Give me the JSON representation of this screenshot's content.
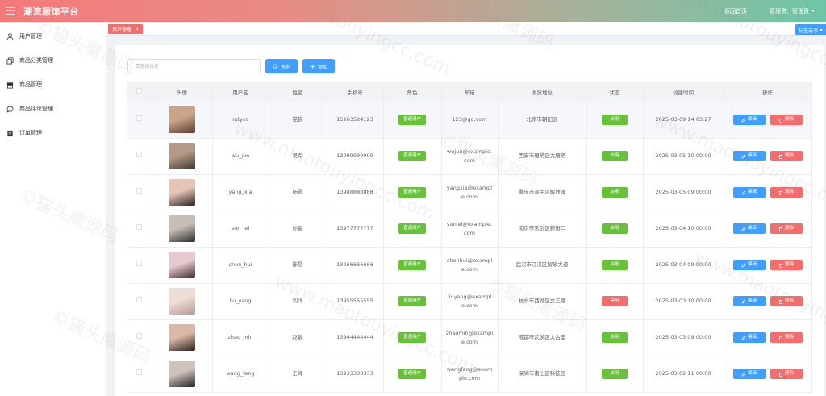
{
  "header": {
    "brand": "潮流服饰平台",
    "back_home": "返回首页",
    "admin_label": "管理员：管理员"
  },
  "sidebar": {
    "items": [
      {
        "label": "用户管理",
        "icon": "user-icon"
      },
      {
        "label": "商品分类管理",
        "icon": "copy-icon"
      },
      {
        "label": "商品管理",
        "icon": "box-icon"
      },
      {
        "label": "商品评论管理",
        "icon": "comment-icon"
      },
      {
        "label": "订单管理",
        "icon": "document-icon"
      }
    ]
  },
  "tabs": {
    "active_label": "用户管理",
    "close_glyph": "×",
    "options_label": "标签选项"
  },
  "search": {
    "placeholder": "请选择姓名",
    "query_label": "查询",
    "add_label": "添加"
  },
  "table": {
    "headers": [
      "",
      "头像",
      "用户名",
      "姓名",
      "手机号",
      "角色",
      "邮箱",
      "收货地址",
      "状态",
      "创建时间",
      "操作"
    ],
    "edit_label": "编辑",
    "delete_label": "删除",
    "rows": [
      {
        "username": "mtycc",
        "name": "猫猫",
        "phone": "15263524123",
        "role": "普通用户",
        "email": [
          "123@qq.com"
        ],
        "address": "北京市朝阳区",
        "status": "启用",
        "created": "2025-03-09 14:03:27",
        "status_color": "#67c23a",
        "avatar_colors": [
          "#c9a489",
          "#5a3b33"
        ]
      },
      {
        "username": "wu_jun",
        "name": "吴军",
        "phone": "13999999999",
        "role": "普通用户",
        "email": [
          "wujun@example.",
          "com"
        ],
        "address": "西安市雁塔区大雁塔",
        "status": "启用",
        "created": "2025-03-05 10:00:00",
        "status_color": "#67c23a",
        "avatar_colors": [
          "#b39a86",
          "#3f3430"
        ]
      },
      {
        "username": "yang_xia",
        "name": "杨霞",
        "phone": "13988888888",
        "role": "普通用户",
        "email": [
          "yangxia@exampl",
          "e.com"
        ],
        "address": "重庆市渝中区解放碑",
        "status": "启用",
        "created": "2025-03-05 09:00:00",
        "status_color": "#67c23a",
        "avatar_colors": [
          "#e3c6b8",
          "#2d211d"
        ]
      },
      {
        "username": "sun_lei",
        "name": "孙磊",
        "phone": "13977777777",
        "role": "普通用户",
        "email": [
          "sunlei@example.",
          "com"
        ],
        "address": "南京市玄武区新街口",
        "status": "启用",
        "created": "2025-03-04 10:00:00",
        "status_color": "#67c23a",
        "avatar_colors": [
          "#c8bdb5",
          "#2a2a2a"
        ]
      },
      {
        "username": "chen_hui",
        "name": "陈慧",
        "phone": "13966666666",
        "role": "普通用户",
        "email": [
          "chenhui@exampl",
          "e.com"
        ],
        "address": "武汉市江汉区解放大道",
        "status": "启用",
        "created": "2025-03-04 09:00:00",
        "status_color": "#67c23a",
        "avatar_colors": [
          "#e8c9cf",
          "#3b2b2b"
        ]
      },
      {
        "username": "liu_yang",
        "name": "刘洋",
        "phone": "13955555555",
        "role": "普通用户",
        "email": [
          "liuyang@exampl",
          "e.com"
        ],
        "address": "杭州市西湖区文三路",
        "status": "禁用",
        "created": "2025-03-03 10:00:00",
        "status_color": "#f56c6c",
        "avatar_colors": [
          "#f0dcd6",
          "#b79a92"
        ]
      },
      {
        "username": "zhao_min",
        "name": "赵敏",
        "phone": "13944444444",
        "role": "普通用户",
        "email": [
          "zhaomin@exampl",
          "e.com"
        ],
        "address": "成都市武侯区太古里",
        "status": "启用",
        "created": "2025-03-03 09:00:00",
        "status_color": "#67c23a",
        "avatar_colors": [
          "#d9b8a8",
          "#2b1f1c"
        ]
      },
      {
        "username": "wang_feng",
        "name": "王峰",
        "phone": "13933333333",
        "role": "普通用户",
        "email": [
          "wangfeng@exam",
          "ple.com"
        ],
        "address": "深圳市南山区科技园",
        "status": "启用",
        "created": "2025-03-02 11:00:00",
        "status_color": "#67c23a",
        "avatar_colors": [
          "#cfc2bb",
          "#222222"
        ]
      }
    ]
  },
  "watermark": {
    "copyright": "©猫头鹰源码",
    "domain": "www.maotouyingcc.com"
  },
  "colors": {
    "primary": "#409eff",
    "success": "#67c23a",
    "danger": "#f56c6c"
  }
}
